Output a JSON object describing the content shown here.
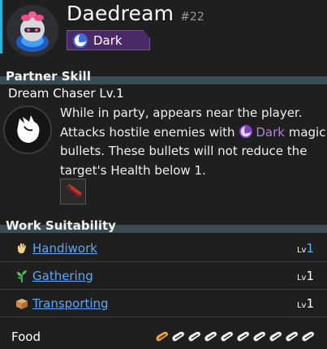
{
  "pal": {
    "name": "Daedream",
    "number": "#22",
    "type": {
      "label": "Dark",
      "color": "#4a2a66"
    }
  },
  "partner_skill": {
    "heading": "Partner Skill",
    "name": "Dream Chaser Lv.1",
    "desc_part1": "While in party, appears near the player. Attacks hostile enemies with ",
    "desc_type_word": "Dark",
    "desc_part2": " magic bullets. These bullets will not reduce the target's Health below 1."
  },
  "work_suitability": {
    "heading": "Work Suitability",
    "items": [
      {
        "label": "Handiwork",
        "icon": "hand-icon",
        "lv_prefix": "Lv",
        "level": "1"
      },
      {
        "label": "Gathering",
        "icon": "sprout-icon",
        "lv_prefix": "Lv",
        "level": "1"
      },
      {
        "label": "Transporting",
        "icon": "box-icon",
        "lv_prefix": "Lv",
        "level": "1"
      }
    ]
  },
  "food": {
    "label": "Food",
    "filled": 1,
    "total": 10,
    "filled_color": "#f0a030",
    "empty_color": "#f2f2f2"
  },
  "colors": {
    "accent": "#29b6d4",
    "link": "#5aa9ff",
    "section_bar": "#3a4d55",
    "dark_type_text": "#b184d8"
  }
}
